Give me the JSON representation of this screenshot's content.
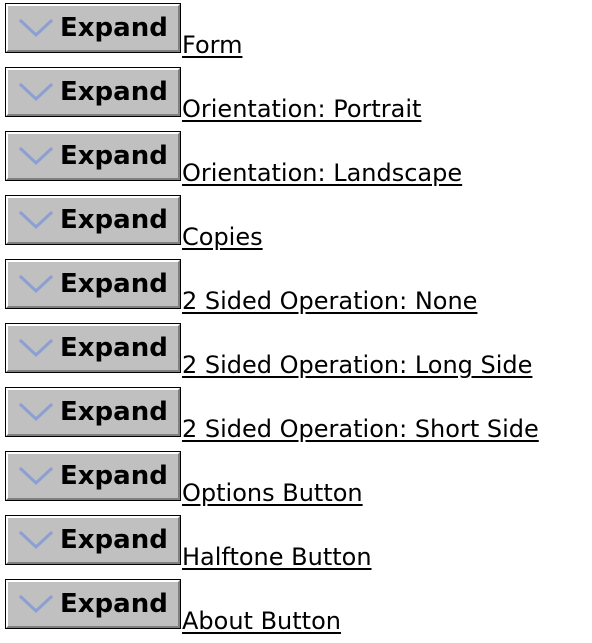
{
  "expand_button_label": "Expand",
  "colors": {
    "button_face": "#c0c0c0",
    "chevron": "#8c9fd2",
    "link_text": "#000000"
  },
  "items": [
    {
      "label": "Form"
    },
    {
      "label": "Orientation: Portrait"
    },
    {
      "label": "Orientation: Landscape"
    },
    {
      "label": "Copies"
    },
    {
      "label": "2 Sided Operation: None"
    },
    {
      "label": "2 Sided Operation: Long Side"
    },
    {
      "label": "2 Sided Operation: Short Side"
    },
    {
      "label": "Options Button"
    },
    {
      "label": "Halftone Button"
    },
    {
      "label": "About Button"
    }
  ]
}
